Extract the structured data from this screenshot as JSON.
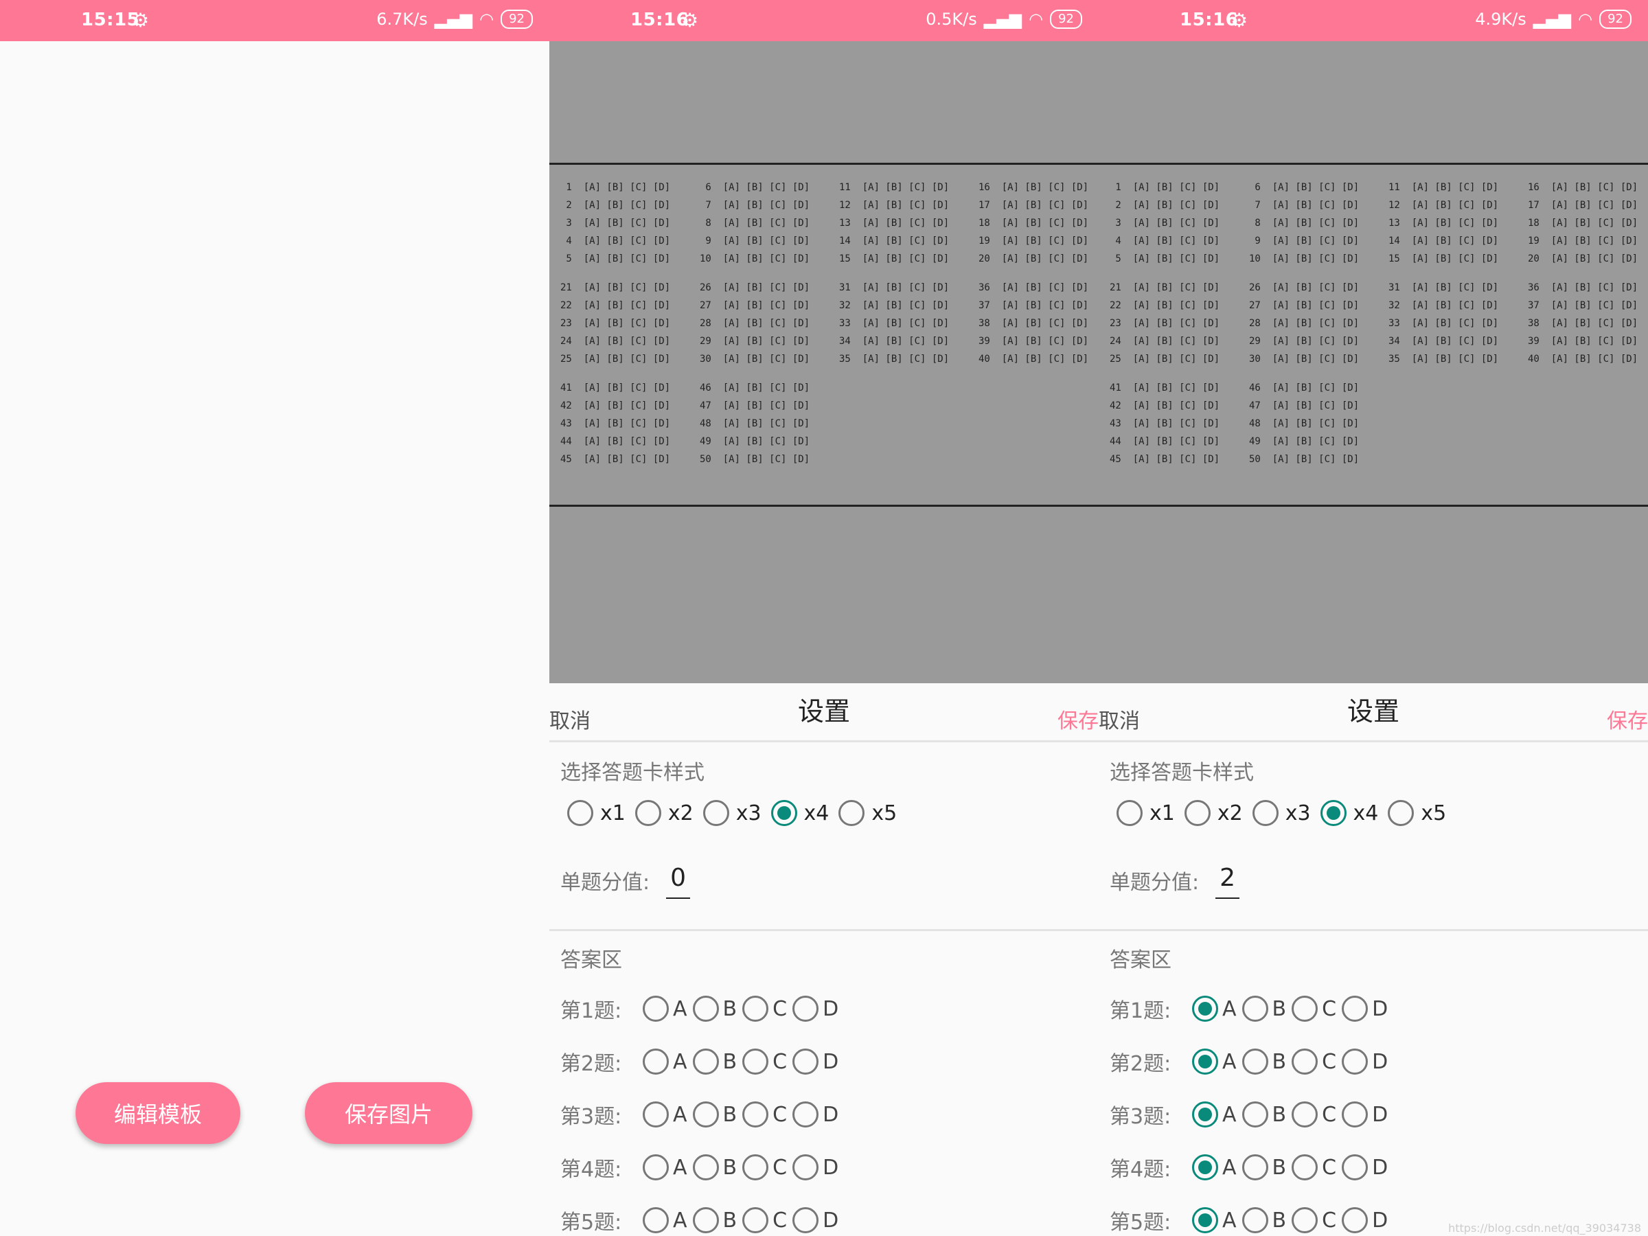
{
  "screens": [
    {
      "status": {
        "time": "15:15",
        "speed": "6.7K/s",
        "battery": "92"
      },
      "buttons": {
        "edit": "编辑模板",
        "save": "保存图片"
      }
    },
    {
      "status": {
        "time": "15:16",
        "speed": "0.5K/s",
        "battery": "92"
      },
      "dialog": {
        "cancel": "取消",
        "title": "设置",
        "save": "保存",
        "style_label": "选择答题卡样式",
        "style_options": [
          "x1",
          "x2",
          "x3",
          "x4",
          "x5"
        ],
        "style_selected": "x4",
        "score_label": "单题分值:",
        "score_value": "0",
        "answer_label": "答案区",
        "questions": [
          {
            "label": "第1题:",
            "selected": ""
          },
          {
            "label": "第2题:",
            "selected": ""
          },
          {
            "label": "第3题:",
            "selected": ""
          },
          {
            "label": "第4题:",
            "selected": ""
          },
          {
            "label": "第5题:",
            "selected": ""
          }
        ],
        "choices": [
          "A",
          "B",
          "C",
          "D"
        ]
      }
    },
    {
      "status": {
        "time": "15:16",
        "speed": "4.9K/s",
        "battery": "92"
      },
      "dialog": {
        "cancel": "取消",
        "title": "设置",
        "save": "保存",
        "style_label": "选择答题卡样式",
        "style_options": [
          "x1",
          "x2",
          "x3",
          "x4",
          "x5"
        ],
        "style_selected": "x4",
        "score_label": "单题分值:",
        "score_value": "2",
        "answer_label": "答案区",
        "questions": [
          {
            "label": "第1题:",
            "selected": "A"
          },
          {
            "label": "第2题:",
            "selected": "A"
          },
          {
            "label": "第3题:",
            "selected": "A"
          },
          {
            "label": "第4题:",
            "selected": "A"
          },
          {
            "label": "第5题:",
            "selected": "A"
          }
        ],
        "choices": [
          "A",
          "B",
          "C",
          "D"
        ]
      }
    }
  ],
  "answer_sheet": {
    "option_text": "[A] [B] [C] [D]",
    "question_count": 50
  },
  "watermark": "https://blog.csdn.net/qq_39034738"
}
